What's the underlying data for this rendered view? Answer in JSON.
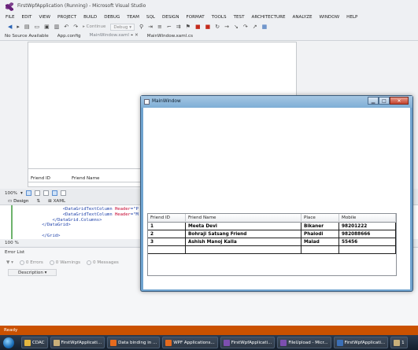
{
  "window": {
    "title": "FirstWpfApplication (Running) - Microsoft Visual Studio"
  },
  "menu": [
    "FILE",
    "EDIT",
    "VIEW",
    "PROJECT",
    "BUILD",
    "DEBUG",
    "TEAM",
    "SQL",
    "DESIGN",
    "FORMAT",
    "TOOLS",
    "TEST",
    "ARCHITECTURE",
    "ANALYZE",
    "WINDOW",
    "HELP"
  ],
  "toolbar": {
    "continue_label": "Continue",
    "config_value": "Debug"
  },
  "doc_tabs": {
    "no_source": "No Source Available",
    "app_config": "App.config",
    "main_window_xaml": "MainWindow.xaml",
    "main_window_cs": "MainWindow.xaml.cs"
  },
  "designer": {
    "columns": [
      "Friend ID",
      "Friend Name"
    ],
    "zoom": "100%",
    "design_label": "Design",
    "xaml_label": "XAML"
  },
  "code": {
    "lines": [
      {
        "indent": "            ",
        "tag_open": "<DataGridTextColumn",
        "attr": " Header",
        "val": "=\"P"
      },
      {
        "indent": "            ",
        "tag_open": "<DataGridTextColumn",
        "attr": " Header",
        "val": "=\"M"
      },
      {
        "indent": "        ",
        "tag_open": "</DataGrid.Columns>",
        "attr": "",
        "val": ""
      },
      {
        "indent": "    ",
        "tag_open": "</DataGrid>",
        "attr": "",
        "val": ""
      },
      {
        "indent": "",
        "tag_open": "",
        "attr": "",
        "val": ""
      },
      {
        "indent": "    ",
        "tag_open": "</Grid>",
        "attr": "",
        "val": ""
      }
    ],
    "zoom_bottom": "100 %"
  },
  "error_list": {
    "title": "Error List",
    "errors": "0 Errors",
    "warnings": "0 Warnings",
    "messages": "0 Messages",
    "description_header": "Description"
  },
  "status": {
    "text": "Ready"
  },
  "taskbar": {
    "items": [
      {
        "label": "CDAC",
        "color": "#e3b640"
      },
      {
        "label": "FirstWpfApplicati...",
        "color": "#c9b07a"
      },
      {
        "label": "Data binding in ...",
        "color": "#e66b1e"
      },
      {
        "label": "WPF Applications...",
        "color": "#e66b1e"
      },
      {
        "label": "FirstWpfApplicati...",
        "color": "#7d4fb0"
      },
      {
        "label": "FileUpload - Micr...",
        "color": "#7d4fb0"
      },
      {
        "label": "FirstWpfApplicati...",
        "color": "#3b6fb6"
      },
      {
        "label": "1",
        "color": "#c9b07a"
      }
    ]
  },
  "main_window": {
    "title": "MainWindow",
    "grid": {
      "columns": [
        "Friend ID",
        "Friend Name",
        "Place",
        "Mobile"
      ],
      "rows": [
        [
          "1",
          "Meeta Devi",
          "Bikaner",
          "98201222"
        ],
        [
          "2",
          "Bohraji Satsang Friend",
          "Phalodi",
          "982088666"
        ],
        [
          "3",
          "Ashish Manoj Kalla",
          "Malad",
          "55456"
        ],
        [
          "",
          "",
          "",
          ""
        ]
      ]
    }
  },
  "colors": {
    "status_bar": "#ca5100",
    "vs_purple": "#68217a"
  }
}
